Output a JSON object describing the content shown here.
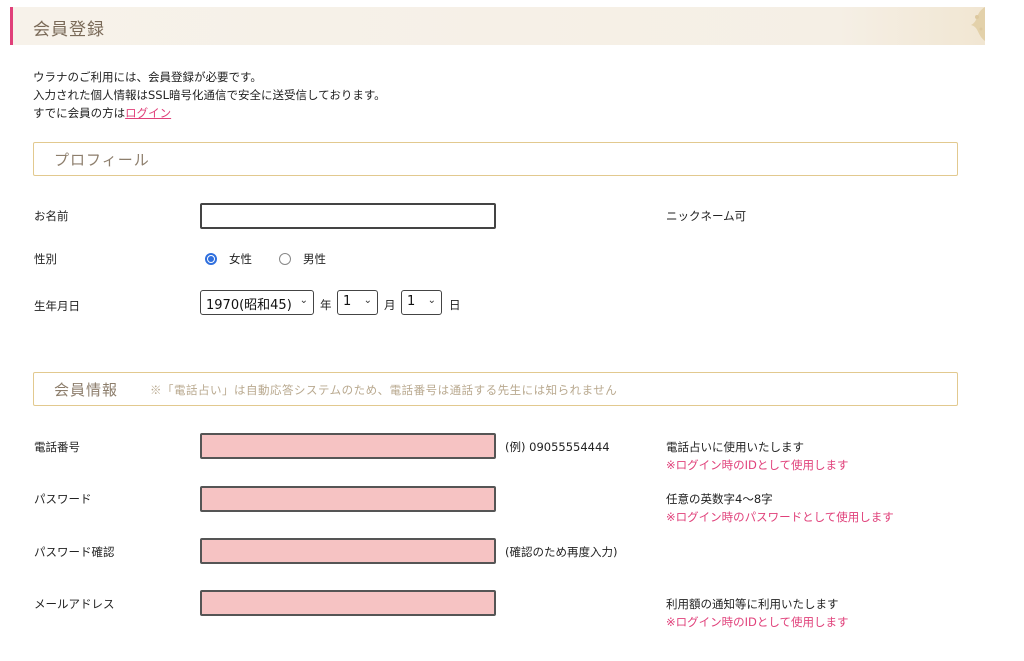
{
  "header": {
    "title": "会員登録"
  },
  "intro": {
    "line1": "ウラナのご利用には、会員登録が必要です。",
    "line2": "入力された個人情報はSSL暗号化通信で安全に送受信しております。",
    "line3_prefix": "すでに会員の方は",
    "login_link": "ログイン"
  },
  "profile": {
    "section_title": "プロフィール",
    "name": {
      "label": "お名前",
      "value": "",
      "note": "ニックネーム可"
    },
    "gender": {
      "label": "性別",
      "options": [
        "女性",
        "男性"
      ],
      "selected": "女性"
    },
    "birthday": {
      "label": "生年月日",
      "year": "1970(昭和45)",
      "year_unit": "年",
      "month": "1",
      "month_unit": "月",
      "day": "1",
      "day_unit": "日"
    }
  },
  "member": {
    "section_title": "会員情報",
    "section_note": "※「電話占い」は自動応答システムのため、電話番号は通話する先生には知られません",
    "phone": {
      "label": "電話番号",
      "value": "",
      "example": "(例) 09055554444",
      "note": "電話占いに使用いたします",
      "note_pink": "※ログイン時のIDとして使用します"
    },
    "password": {
      "label": "パスワード",
      "value": "",
      "note": "任意の英数字4〜8字",
      "note_pink": "※ログイン時のパスワードとして使用します"
    },
    "password_confirm": {
      "label": "パスワード確認",
      "value": "",
      "hint": "(確認のため再度入力)"
    },
    "email": {
      "label": "メールアドレス",
      "value": "",
      "note": "利用額の通知等に利用いたします",
      "note_pink": "※ログイン時のIDとして使用します"
    }
  },
  "colors": {
    "accent": "#e0407a",
    "invalid_field": "#f6c3c3",
    "section_border": "#e2c98f",
    "radio": "#2f6fde"
  }
}
